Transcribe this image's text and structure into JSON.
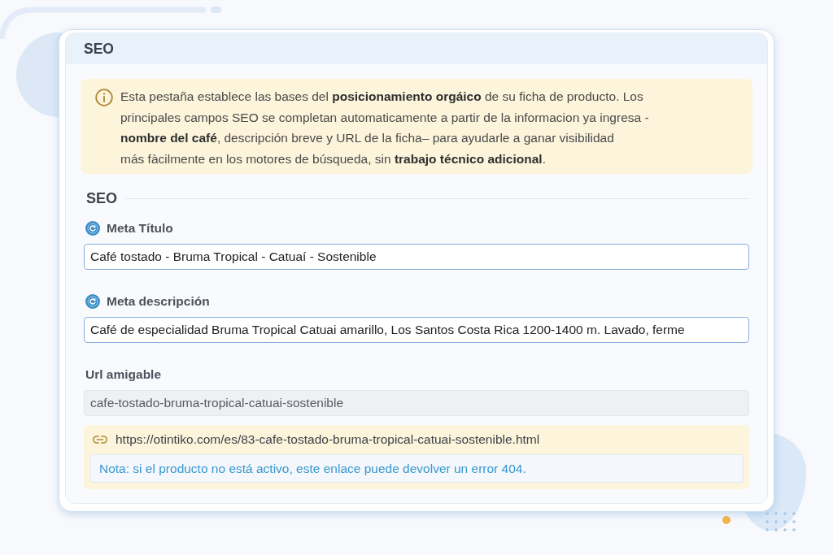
{
  "panel": {
    "title": "SEO"
  },
  "notice": {
    "text": "Esta pestaña establece las bases del **posicionamiento orgáico** de su ficha de producto. Los\nprincipales campos SEO se completan automaticamente a partir de la informacion ya ingresa -\n**nombre del café**, descripción breve y URL de la ficha– para ayudarle a ganar visibilidad\nmás fàcilmente en los motores de búsqueda, sin **trabajo técnico adicional**."
  },
  "section": {
    "title": "SEO"
  },
  "fields": [
    {
      "kind": "meta",
      "label": "Meta Título",
      "value": "Café tostado - Bruma Tropical - Catuaí - Sostenible",
      "disabled": false
    },
    {
      "kind": "meta",
      "label": "Meta descripción",
      "value": "Café de especialidad Bruma Tropical Catuai amarillo, Los Santos Costa Rica 1200-1400 m. Lavado, ferme",
      "disabled": false
    },
    {
      "kind": "plain",
      "label": "Url amigable",
      "value": "cafe-tostado-bruma-tropical-catuai-sostenible",
      "disabled": true
    }
  ],
  "preview": {
    "url": "https://otintiko.com/es/83-cafe-tostado-bruma-tropical-catuai-sostenible.html",
    "note": "Nota: si el producto no está activo, este enlace puede devolver un error 404."
  }
}
